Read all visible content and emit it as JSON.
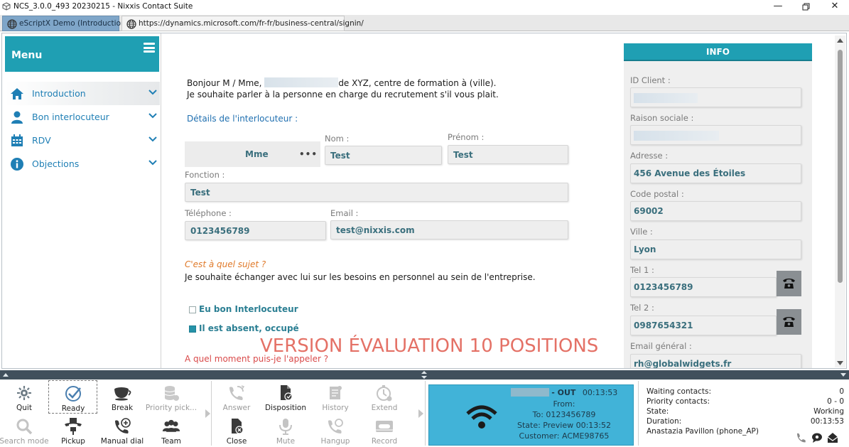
{
  "window": {
    "title": "NCS_3.0.0_493 20230215 - Nixxis Contact Suite"
  },
  "tabs": [
    {
      "label": "eScriptX Demo (Introduction)",
      "active": true
    },
    {
      "label": "https://dynamics.microsoft.com/fr-fr/business-central/signin/",
      "active": false
    }
  ],
  "sidebar": {
    "title": "Menu",
    "items": [
      {
        "label": "Introduction",
        "icon": "home-icon"
      },
      {
        "label": "Bon interlocuteur",
        "icon": "person-icon"
      },
      {
        "label": "RDV",
        "icon": "calendar-icon"
      },
      {
        "label": "Objections",
        "icon": "info-icon"
      }
    ]
  },
  "script": {
    "greeting_prefix": "Bonjour M / Mme,",
    "greeting_suffix": "de XYZ, centre de formation à (ville).",
    "greeting_line2": "Je souhaite parler à la personne en charge du recrutement s'il vous plait.",
    "details_title": "Détails de l'interlocuteur :",
    "civility": "Mme",
    "nom_label": "Nom :",
    "nom": "Test",
    "prenom_label": "Prénom :",
    "prenom": "Test",
    "fonction_label": "Fonction :",
    "fonction": "Test",
    "telephone_label": "Téléphone :",
    "telephone": "0123456789",
    "email_label": "Email :",
    "email": "test@nixxis.com",
    "question1": "C'est à quel sujet ?",
    "answer1": "Je souhaite échanger avec lui sur les besoins en personnel au sein de l'entreprise.",
    "option1": "Eu bon Interlocuteur",
    "option2": "Il est absent, occupé",
    "option1_checked": false,
    "option2_checked": true,
    "question2": "A quel moment puis-je l'appeler ?",
    "watermark": "VERSION ÉVALUATION 10 POSITIONS"
  },
  "info": {
    "title": "INFO",
    "id_client_label": "ID Client :",
    "raison_sociale_label": "Raison sociale :",
    "adresse_label": "Adresse :",
    "adresse": "456 Avenue des Étoiles",
    "code_postal_label": "Code postal :",
    "code_postal": "69002",
    "ville_label": "Ville :",
    "ville": "Lyon",
    "tel1_label": "Tel 1 :",
    "tel1": "0123456789",
    "tel2_label": "Tel 2 :",
    "tel2": "0987654321",
    "email_label": "Email général :",
    "email": "rh@globalwidgets.fr"
  },
  "toolbar": {
    "quit": "Quit",
    "ready": "Ready",
    "break": "Break",
    "priority_pick": "Priority pick...",
    "search_mode": "Search mode",
    "pickup": "Pickup",
    "manual_dial": "Manual dial",
    "team": "Team",
    "answer": "Answer",
    "disposition": "Disposition",
    "history": "History",
    "extend": "Extend",
    "close": "Close",
    "mute": "Mute",
    "hangup": "Hangup",
    "record": "Record"
  },
  "call": {
    "direction": "- OUT",
    "duration": "00:13:53",
    "from_label": "From:",
    "to": "To: 0123456789",
    "state": "State: Preview  00:13:52",
    "customer": "Customer: ACME98765"
  },
  "stats": {
    "waiting_label": "Waiting contacts:",
    "waiting": "0",
    "priority_label": "Priority contacts:",
    "priority": "0 - 0",
    "state_label": "State:",
    "state": "Working",
    "duration_label": "Duration:",
    "duration": "00:13:53",
    "agent": "Anastazia Pavillon (phone_AP)"
  },
  "colors": {
    "teal": "#1f9fb3",
    "call_panel": "#41b3d8",
    "link_blue": "#1f7fb5",
    "field_text": "#3a6f7d",
    "watermark": "#e36a5e"
  }
}
